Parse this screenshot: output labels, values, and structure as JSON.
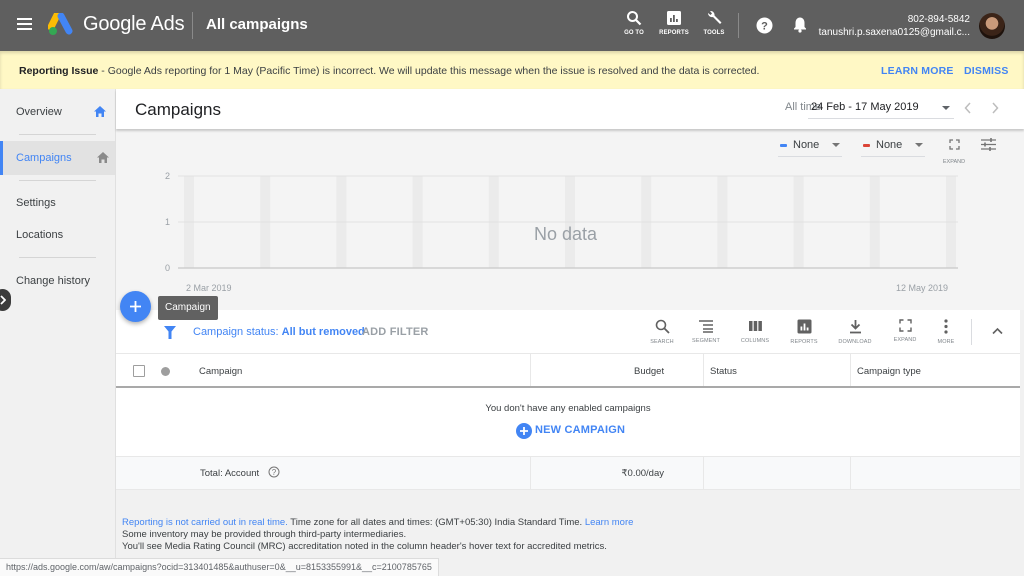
{
  "topbar": {
    "brand": "Google Ads",
    "context": "All campaigns",
    "tools": [
      {
        "icon": "search-icon",
        "label": "GO TO"
      },
      {
        "icon": "reports-icon",
        "label": "REPORTS"
      },
      {
        "icon": "wrench-icon",
        "label": "TOOLS"
      }
    ],
    "account_id": "802-894-5842",
    "account_email": "tanushri.p.saxena0125@gmail.c..."
  },
  "banner": {
    "title": "Reporting Issue",
    "message": " - Google Ads reporting for 1 May (Pacific Time) is incorrect. We will update this message when the issue is resolved and the data is corrected.",
    "learn_more": "LEARN MORE",
    "dismiss": "DISMISS"
  },
  "sidebar": {
    "items": [
      {
        "label": "Overview",
        "active": false,
        "home_icon": true
      },
      {
        "label": "Campaigns",
        "active": true,
        "home_icon": true
      },
      {
        "label": "Settings",
        "active": false
      },
      {
        "label": "Locations",
        "active": false
      },
      {
        "label": "Change history",
        "active": false
      }
    ]
  },
  "header": {
    "title": "Campaigns",
    "date_label": "All time",
    "date_range": "24 Feb - 17 May 2019"
  },
  "chart_controls": {
    "metric1": {
      "label": "None",
      "color": "#4285f4"
    },
    "metric2": {
      "label": "None",
      "color": "#db4437"
    },
    "expand_label": "EXPAND"
  },
  "chart_data": {
    "type": "line",
    "title": "",
    "series": [],
    "y_ticks": [
      "0",
      "1",
      "2"
    ],
    "ylim": [
      0,
      2
    ],
    "x_start_label": "2 Mar 2019",
    "x_end_label": "12 May 2019",
    "weekly_bands": 11,
    "empty_message": "No data",
    "grid": true
  },
  "fab": {
    "tooltip": "Campaign"
  },
  "filterbar": {
    "filter_prefix": "Campaign status: ",
    "filter_value": "All but removed",
    "add_filter": "ADD FILTER",
    "tools": [
      {
        "icon": "search-icon",
        "label": "SEARCH"
      },
      {
        "icon": "segment-icon",
        "label": "SEGMENT"
      },
      {
        "icon": "columns-icon",
        "label": "COLUMNS"
      },
      {
        "icon": "reports-icon",
        "label": "REPORTS"
      },
      {
        "icon": "download-icon",
        "label": "DOWNLOAD"
      },
      {
        "icon": "expand-icon",
        "label": "EXPAND"
      },
      {
        "icon": "more-icon",
        "label": "MORE"
      }
    ]
  },
  "table": {
    "columns": [
      "Campaign",
      "Budget",
      "Status",
      "Campaign type"
    ],
    "empty_message": "You don't have any enabled campaigns",
    "new_campaign": "NEW CAMPAIGN",
    "total": {
      "label": "Total: Account",
      "budget": "₹0.00/day",
      "status": "",
      "type": ""
    }
  },
  "footer": {
    "line1_link": "Reporting is not carried out in real time.",
    "line1_text": " Time zone for all dates and times: (GMT+05:30) India Standard Time. ",
    "line1_link2": "Learn more",
    "line2": "Some inventory may be provided through third-party intermediaries.",
    "line3": "You'll see Media Rating Council (MRC) accreditation noted in the column header's hover text for accredited metrics."
  },
  "statusbar": {
    "url": "https://ads.google.com/aw/campaigns?ocid=313401485&authuser=0&__u=8153355991&__c=2100785765"
  }
}
